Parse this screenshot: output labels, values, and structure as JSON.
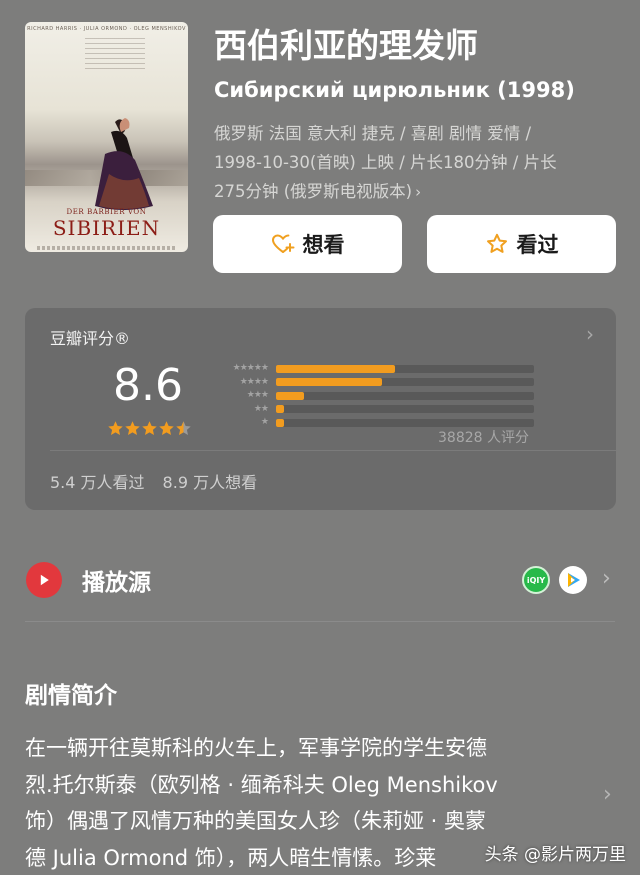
{
  "movie": {
    "title": "西伯利亚的理发师",
    "original_title": "Сибирский цирюльник (1998)",
    "meta_lines": [
      "俄罗斯 法国 意大利 捷克 / 喜剧 剧情 爱情 /",
      "1998-10-30(首映) 上映 / 片长180分钟 / 片长",
      "275分钟 (俄罗斯电视版本)"
    ],
    "meta_chevron": "›"
  },
  "poster": {
    "top_credits": "RICHARD HARRIS · JULIA ORMOND · OLEG MENSHIKOV",
    "title_small": "DER BARBIER VON",
    "title": "SIBIRIEN"
  },
  "actions": {
    "want_label": "想看",
    "seen_label": "看过"
  },
  "rating": {
    "label": "豆瓣评分®",
    "score": "8.6",
    "star_value": 4.5,
    "distribution": [
      {
        "stars": 5,
        "fraction": 0.46
      },
      {
        "stars": 4,
        "fraction": 0.41
      },
      {
        "stars": 3,
        "fraction": 0.11
      },
      {
        "stars": 2,
        "fraction": 0.03
      },
      {
        "stars": 1,
        "fraction": 0.03
      }
    ],
    "count_text": "38828 人评分",
    "seen_text": "5.4 万人看过",
    "want_text": "8.9 万人想看",
    "chevron": "›"
  },
  "play_source": {
    "label": "播放源",
    "iqiyi_text": "iQIY",
    "chevron": "›"
  },
  "synopsis": {
    "heading": "剧情简介",
    "lines": [
      "在一辆开往莫斯科的火车上，军事学院的学生安德",
      "烈.托尔斯泰（欧列格 · 缅希科夫 Oleg Menshikov",
      "饰）偶遇了风情万种的美国女人珍（朱莉娅 · 奥蒙",
      "德 Julia Ormond 饰），两人暗生情愫。珍莱"
    ],
    "chevron": "›"
  },
  "watermark": "头条 @影片两万里",
  "colors": {
    "background": "#7d7d7c",
    "card": "#6b6b6b",
    "accent_orange": "#f29c1f",
    "play_red": "#e2383d"
  }
}
